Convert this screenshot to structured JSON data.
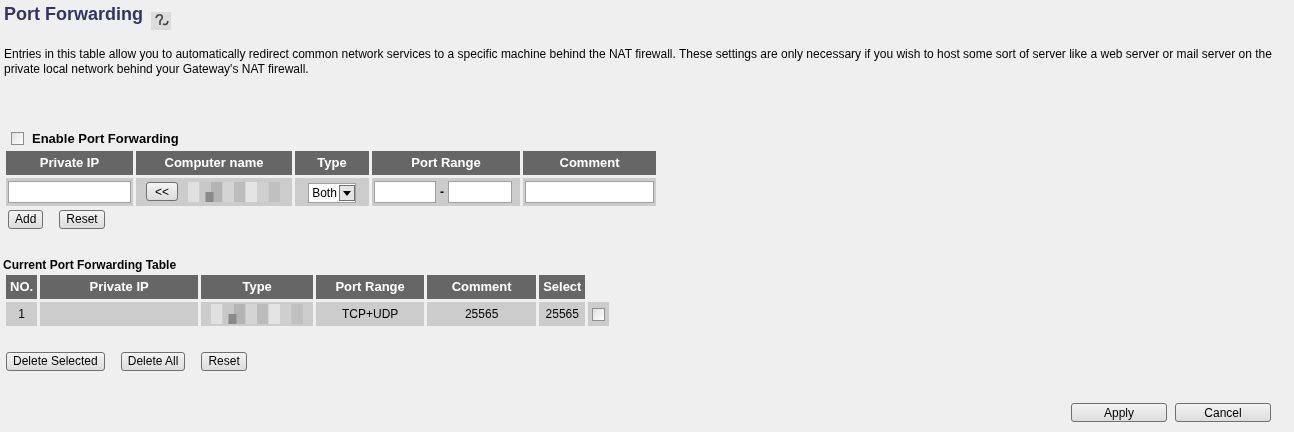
{
  "title": "Port Forwarding",
  "description": "Entries in this table allow you to automatically redirect common network services to a specific machine behind the NAT firewall. These settings are only necessary if you wish to host some sort of server like a web server or mail server on the private local network behind your Gateway's NAT firewall.",
  "enable": {
    "label": "Enable Port Forwarding",
    "checked": false
  },
  "form": {
    "columns": [
      "Private IP",
      "Computer name",
      "Type",
      "Port Range",
      "Comment"
    ],
    "pick_button": "<<",
    "type_value": "Both",
    "range_separator": "-"
  },
  "form_buttons": [
    "Add",
    "Reset"
  ],
  "table": {
    "title": "Current Port Forwarding Table",
    "columns": [
      "NO.",
      "Private IP",
      "Type",
      "Port Range",
      "Comment",
      "Select"
    ],
    "rows": [
      {
        "cells": [
          "1",
          "",
          null,
          "TCP+UDP",
          "25565",
          "25565"
        ],
        "checked": false
      }
    ]
  },
  "table_buttons": [
    "Delete Selected",
    "Delete All",
    "Reset"
  ],
  "footer_buttons": [
    "Apply",
    "Cancel"
  ]
}
